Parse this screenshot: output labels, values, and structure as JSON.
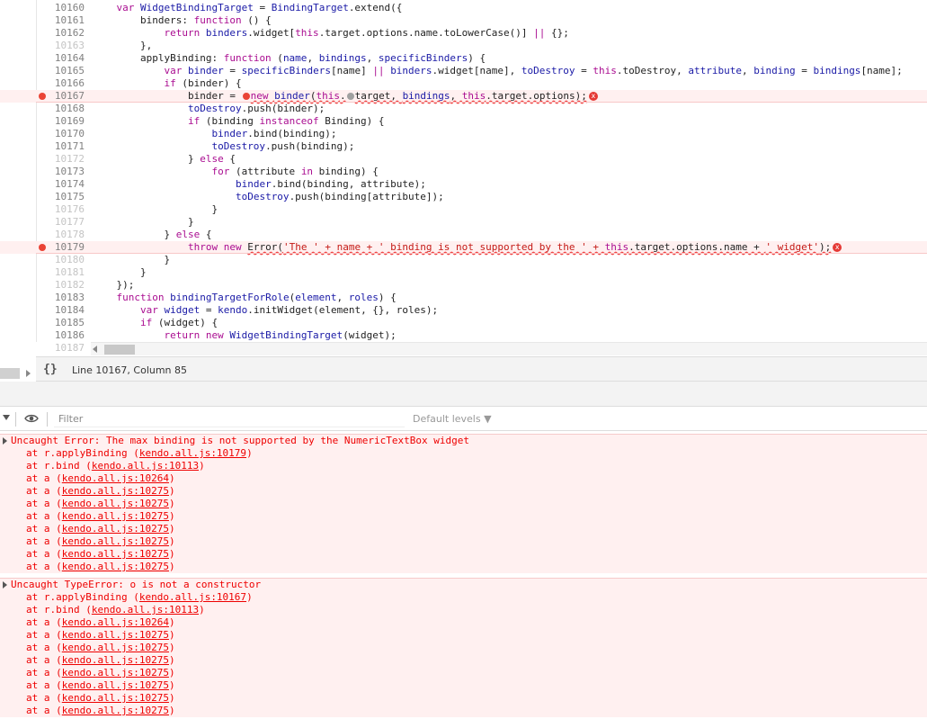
{
  "editor": {
    "lines": [
      {
        "num": "10160",
        "faint": false,
        "bp": false,
        "indent": "    ",
        "tokens": [
          [
            "kw",
            "var "
          ],
          [
            "id",
            "WidgetBindingTarget"
          ],
          [
            "pl",
            " = "
          ],
          [
            "id",
            "BindingTarget"
          ],
          [
            "pl",
            ".extend({"
          ]
        ]
      },
      {
        "num": "10161",
        "faint": false,
        "bp": false,
        "indent": "        ",
        "tokens": [
          [
            "pl",
            "binders: "
          ],
          [
            "kw",
            "function"
          ],
          [
            "pl",
            " () {"
          ]
        ]
      },
      {
        "num": "10162",
        "faint": false,
        "bp": false,
        "indent": "            ",
        "tokens": [
          [
            "kw",
            "return "
          ],
          [
            "id",
            "binders"
          ],
          [
            "pl",
            ".widget["
          ],
          [
            "kw",
            "this"
          ],
          [
            "pl",
            ".target.options.name.toLowerCase()] "
          ],
          [
            "kw",
            "||"
          ],
          [
            "pl",
            " {};"
          ]
        ]
      },
      {
        "num": "10163",
        "faint": true,
        "bp": false,
        "indent": "        ",
        "tokens": [
          [
            "pl",
            "},"
          ]
        ]
      },
      {
        "num": "10164",
        "faint": false,
        "bp": false,
        "indent": "        ",
        "tokens": [
          [
            "pl",
            "applyBinding: "
          ],
          [
            "kw",
            "function"
          ],
          [
            "pl",
            " ("
          ],
          [
            "id",
            "name"
          ],
          [
            "pl",
            ", "
          ],
          [
            "id",
            "bindings"
          ],
          [
            "pl",
            ", "
          ],
          [
            "id",
            "specificBinders"
          ],
          [
            "pl",
            ") {"
          ]
        ]
      },
      {
        "num": "10165",
        "faint": false,
        "bp": false,
        "indent": "            ",
        "tokens": [
          [
            "kw",
            "var "
          ],
          [
            "id",
            "binder"
          ],
          [
            "pl",
            " = "
          ],
          [
            "id",
            "specificBinders"
          ],
          [
            "pl",
            "[name] "
          ],
          [
            "kw",
            "||"
          ],
          [
            "pl",
            " "
          ],
          [
            "id",
            "binders"
          ],
          [
            "pl",
            ".widget[name], "
          ],
          [
            "id",
            "toDestroy"
          ],
          [
            "pl",
            " = "
          ],
          [
            "kw",
            "this"
          ],
          [
            "pl",
            ".toDestroy, "
          ],
          [
            "id",
            "attribute"
          ],
          [
            "pl",
            ", "
          ],
          [
            "id",
            "binding"
          ],
          [
            "pl",
            " = "
          ],
          [
            "id",
            "bindings"
          ],
          [
            "pl",
            "[name];"
          ]
        ]
      },
      {
        "num": "10166",
        "faint": false,
        "bp": false,
        "indent": "            ",
        "tokens": [
          [
            "kw",
            "if"
          ],
          [
            "pl",
            " (binder) {"
          ]
        ]
      },
      {
        "num": "10167",
        "faint": false,
        "bp": true,
        "err": true,
        "indent": "                ",
        "tokens": [
          [
            "pl",
            "binder = "
          ],
          [
            "bpdot",
            ""
          ],
          [
            "sq_kw",
            "new "
          ],
          [
            "sq_id",
            "binder"
          ],
          [
            "sq_pl",
            "("
          ],
          [
            "sq_kw",
            "this"
          ],
          [
            "sq_pl",
            "."
          ],
          [
            "greydot",
            ""
          ],
          [
            "sq_pl",
            "target, "
          ],
          [
            "sq_id",
            "bindings"
          ],
          [
            "sq_pl",
            ", "
          ],
          [
            "sq_kw",
            "this"
          ],
          [
            "sq_pl",
            ".target.options);"
          ],
          [
            "errx",
            "x"
          ]
        ]
      },
      {
        "num": "10168",
        "faint": false,
        "bp": false,
        "indent": "                ",
        "tokens": [
          [
            "id",
            "toDestroy"
          ],
          [
            "pl",
            ".push(binder);"
          ]
        ]
      },
      {
        "num": "10169",
        "faint": false,
        "bp": false,
        "indent": "                ",
        "tokens": [
          [
            "kw",
            "if"
          ],
          [
            "pl",
            " (binding "
          ],
          [
            "kw",
            "instanceof"
          ],
          [
            "pl",
            " Binding) {"
          ]
        ]
      },
      {
        "num": "10170",
        "faint": false,
        "bp": false,
        "indent": "                    ",
        "tokens": [
          [
            "id",
            "binder"
          ],
          [
            "pl",
            ".bind(binding);"
          ]
        ]
      },
      {
        "num": "10171",
        "faint": false,
        "bp": false,
        "indent": "                    ",
        "tokens": [
          [
            "id",
            "toDestroy"
          ],
          [
            "pl",
            ".push(binding);"
          ]
        ]
      },
      {
        "num": "10172",
        "faint": true,
        "bp": false,
        "indent": "                ",
        "tokens": [
          [
            "pl",
            "} "
          ],
          [
            "kw",
            "else"
          ],
          [
            "pl",
            " {"
          ]
        ]
      },
      {
        "num": "10173",
        "faint": false,
        "bp": false,
        "indent": "                    ",
        "tokens": [
          [
            "kw",
            "for"
          ],
          [
            "pl",
            " (attribute "
          ],
          [
            "kw",
            "in"
          ],
          [
            "pl",
            " binding) {"
          ]
        ]
      },
      {
        "num": "10174",
        "faint": false,
        "bp": false,
        "indent": "                        ",
        "tokens": [
          [
            "id",
            "binder"
          ],
          [
            "pl",
            ".bind(binding, attribute);"
          ]
        ]
      },
      {
        "num": "10175",
        "faint": false,
        "bp": false,
        "indent": "                        ",
        "tokens": [
          [
            "id",
            "toDestroy"
          ],
          [
            "pl",
            ".push(binding[attribute]);"
          ]
        ]
      },
      {
        "num": "10176",
        "faint": true,
        "bp": false,
        "indent": "                    ",
        "tokens": [
          [
            "pl",
            "}"
          ]
        ]
      },
      {
        "num": "10177",
        "faint": true,
        "bp": false,
        "indent": "                ",
        "tokens": [
          [
            "pl",
            "}"
          ]
        ]
      },
      {
        "num": "10178",
        "faint": true,
        "bp": false,
        "indent": "            ",
        "tokens": [
          [
            "pl",
            "} "
          ],
          [
            "kw",
            "else"
          ],
          [
            "pl",
            " {"
          ]
        ]
      },
      {
        "num": "10179",
        "faint": false,
        "bp": true,
        "err": true,
        "indent": "                ",
        "tokens": [
          [
            "kw",
            "throw "
          ],
          [
            "kw",
            "new "
          ],
          [
            "sq_pl",
            "Error("
          ],
          [
            "sq_str",
            "'The ' + name + ' binding is not supported by the ' + "
          ],
          [
            "sq_kw",
            "this"
          ],
          [
            "sq_pl",
            ".target.options.name + "
          ],
          [
            "sq_str",
            "' widget'"
          ],
          [
            "sq_pl",
            ");"
          ],
          [
            "errx",
            "x"
          ]
        ]
      },
      {
        "num": "10180",
        "faint": true,
        "bp": false,
        "indent": "            ",
        "tokens": [
          [
            "pl",
            "}"
          ]
        ]
      },
      {
        "num": "10181",
        "faint": true,
        "bp": false,
        "indent": "        ",
        "tokens": [
          [
            "pl",
            "}"
          ]
        ]
      },
      {
        "num": "10182",
        "faint": true,
        "bp": false,
        "indent": "    ",
        "tokens": [
          [
            "pl",
            "});"
          ]
        ]
      },
      {
        "num": "10183",
        "faint": false,
        "bp": false,
        "indent": "    ",
        "tokens": [
          [
            "kw",
            "function "
          ],
          [
            "id",
            "bindingTargetForRole"
          ],
          [
            "pl",
            "("
          ],
          [
            "id",
            "element"
          ],
          [
            "pl",
            ", "
          ],
          [
            "id",
            "roles"
          ],
          [
            "pl",
            ") {"
          ]
        ]
      },
      {
        "num": "10184",
        "faint": false,
        "bp": false,
        "indent": "        ",
        "tokens": [
          [
            "kw",
            "var "
          ],
          [
            "id",
            "widget"
          ],
          [
            "pl",
            " = "
          ],
          [
            "id",
            "kendo"
          ],
          [
            "pl",
            ".initWidget(element, {}, roles);"
          ]
        ]
      },
      {
        "num": "10185",
        "faint": false,
        "bp": false,
        "indent": "        ",
        "tokens": [
          [
            "kw",
            "if"
          ],
          [
            "pl",
            " (widget) {"
          ]
        ]
      },
      {
        "num": "10186",
        "faint": false,
        "bp": false,
        "indent": "            ",
        "tokens": [
          [
            "kw",
            "return new "
          ],
          [
            "id",
            "WidgetBindingTarget"
          ],
          [
            "pl",
            "(widget);"
          ]
        ]
      },
      {
        "num": "10187",
        "faint": true,
        "bp": false,
        "indent": "",
        "tokens": []
      }
    ]
  },
  "status_bar": {
    "pretty_print": "{}",
    "cursor_position": "Line 10167, Column 85"
  },
  "console_toolbar": {
    "filter_placeholder": "Filter",
    "levels_label": "Default levels ▼"
  },
  "console": {
    "messages": [
      {
        "text": "Uncaught Error: The max binding is not supported by the NumericTextBox widget",
        "frames": [
          {
            "fn": "at r.applyBinding (",
            "loc": "kendo.all.js:10179",
            "end": ")"
          },
          {
            "fn": "at r.bind (",
            "loc": "kendo.all.js:10113",
            "end": ")"
          },
          {
            "fn": "at a (",
            "loc": "kendo.all.js:10264",
            "end": ")"
          },
          {
            "fn": "at a (",
            "loc": "kendo.all.js:10275",
            "end": ")"
          },
          {
            "fn": "at a (",
            "loc": "kendo.all.js:10275",
            "end": ")"
          },
          {
            "fn": "at a (",
            "loc": "kendo.all.js:10275",
            "end": ")"
          },
          {
            "fn": "at a (",
            "loc": "kendo.all.js:10275",
            "end": ")"
          },
          {
            "fn": "at a (",
            "loc": "kendo.all.js:10275",
            "end": ")"
          },
          {
            "fn": "at a (",
            "loc": "kendo.all.js:10275",
            "end": ")"
          },
          {
            "fn": "at a (",
            "loc": "kendo.all.js:10275",
            "end": ")"
          }
        ]
      },
      {
        "text": "Uncaught TypeError: o is not a constructor",
        "frames": [
          {
            "fn": "at r.applyBinding (",
            "loc": "kendo.all.js:10167",
            "end": ")"
          },
          {
            "fn": "at r.bind (",
            "loc": "kendo.all.js:10113",
            "end": ")"
          },
          {
            "fn": "at a (",
            "loc": "kendo.all.js:10264",
            "end": ")"
          },
          {
            "fn": "at a (",
            "loc": "kendo.all.js:10275",
            "end": ")"
          },
          {
            "fn": "at a (",
            "loc": "kendo.all.js:10275",
            "end": ")"
          },
          {
            "fn": "at a (",
            "loc": "kendo.all.js:10275",
            "end": ")"
          },
          {
            "fn": "at a (",
            "loc": "kendo.all.js:10275",
            "end": ")"
          },
          {
            "fn": "at a (",
            "loc": "kendo.all.js:10275",
            "end": ")"
          },
          {
            "fn": "at a (",
            "loc": "kendo.all.js:10275",
            "end": ")"
          },
          {
            "fn": "at a (",
            "loc": "kendo.all.js:10275",
            "end": ")"
          }
        ]
      }
    ]
  },
  "colors": {
    "keyword": "#aa0d91",
    "identifier": "#1a1aa6",
    "string": "#c41a16",
    "error_text": "#e00000",
    "error_bg": "#fff0f0",
    "breakpoint": "#ea4335"
  }
}
